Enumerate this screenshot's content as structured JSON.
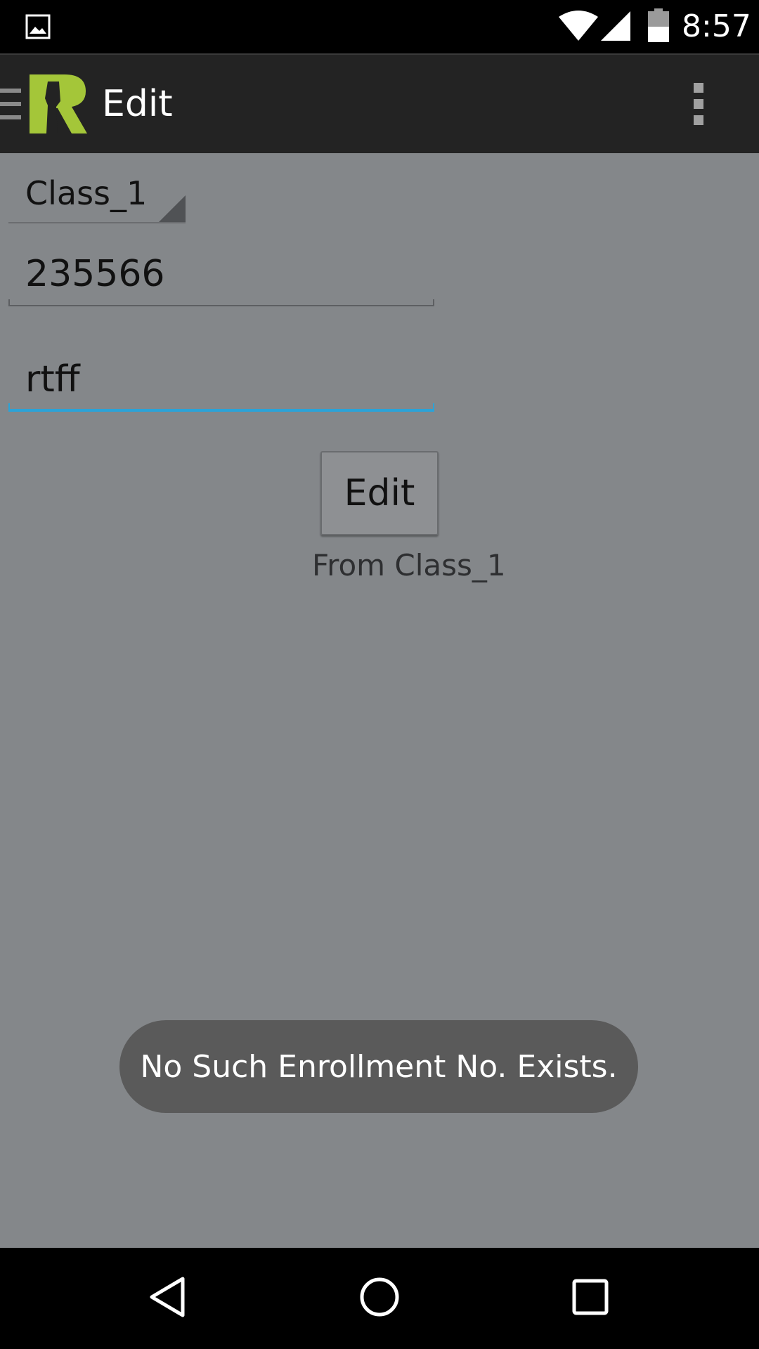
{
  "status_bar": {
    "time": "8:57",
    "icons": [
      "gallery-icon",
      "wifi-icon",
      "signal-icon",
      "battery-icon"
    ]
  },
  "action_bar": {
    "title": "Edit",
    "icons": [
      "drawer-icon",
      "app-logo",
      "overflow-menu-icon"
    ],
    "logo_color": "#a4c639"
  },
  "form": {
    "class_spinner": {
      "selected": "Class_1"
    },
    "enrollment_field": {
      "value": "235566"
    },
    "name_field": {
      "value": "rtff",
      "focused": true
    },
    "edit_button_label": "Edit",
    "from_label": "From Class_1"
  },
  "toast": {
    "message": "No Such Enrollment No. Exists."
  },
  "nav_bar": {
    "icons": [
      "back-icon",
      "home-icon",
      "recents-icon"
    ]
  },
  "colors": {
    "content_bg": "#84878a",
    "action_bar_bg": "#232323",
    "focus_accent": "#2aa3d8",
    "toast_bg": "#5a5a5a"
  }
}
